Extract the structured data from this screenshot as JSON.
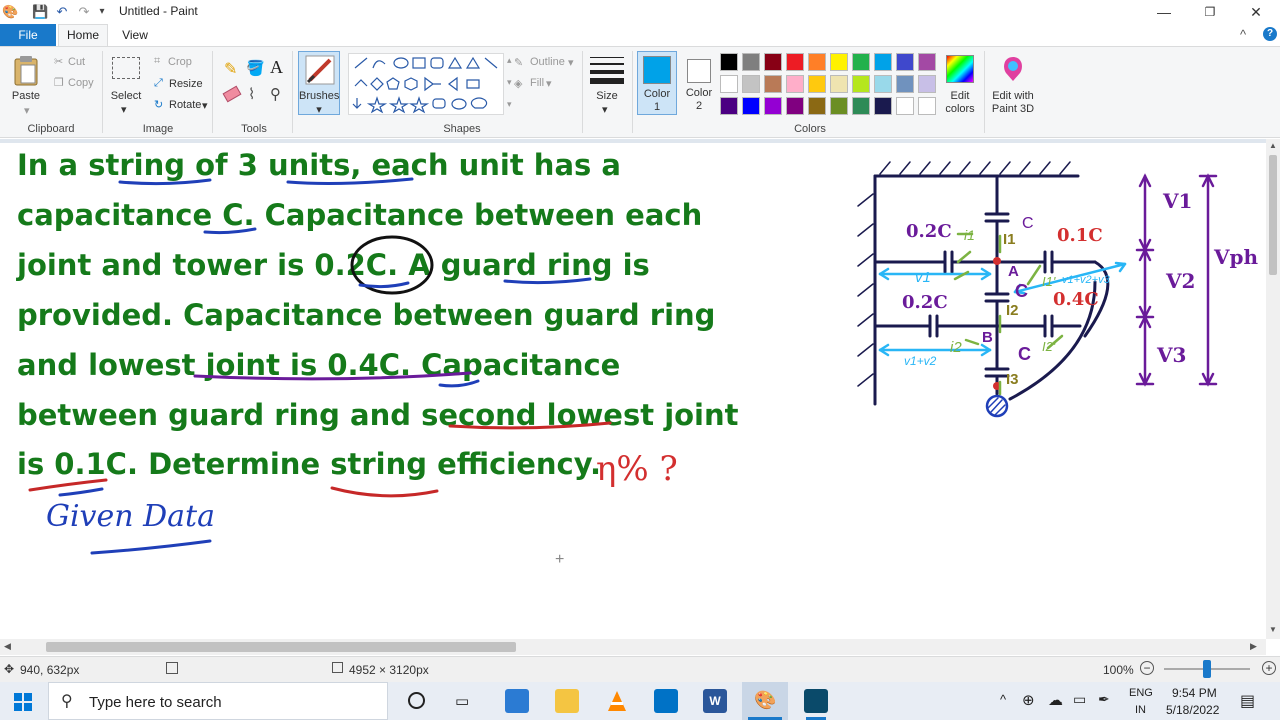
{
  "window": {
    "title": "Untitled - Paint",
    "controls": {
      "minimize": "—",
      "maximize": "❐",
      "close": "✕"
    }
  },
  "quick_access": {
    "save": "💾",
    "undo": "↶",
    "redo": "↷",
    "customize": "▾"
  },
  "tabs": [
    {
      "label": "File"
    },
    {
      "label": "Home"
    },
    {
      "label": "View"
    }
  ],
  "help": {
    "collapse": "^",
    "help": "?"
  },
  "ribbon": {
    "clipboard": {
      "group": "Clipboard",
      "paste": "Paste",
      "cut": "Cut",
      "copy": "Copy"
    },
    "image": {
      "group": "Image",
      "select": "Select",
      "crop": "Crop",
      "resize": "Resize",
      "rotate": "Rotate"
    },
    "tools": {
      "group": "Tools"
    },
    "brushes": {
      "label": "Brushes"
    },
    "shapes": {
      "group": "Shapes",
      "outline": "Outline",
      "fill": "Fill"
    },
    "size": {
      "label": "Size"
    },
    "color1": {
      "label": "Color",
      "num": "1"
    },
    "color2": {
      "label": "Color",
      "num": "2"
    },
    "colors": {
      "group": "Colors",
      "edit": "Edit colors",
      "edit_l1": "Edit",
      "edit_l2": "colors"
    },
    "paint3d": {
      "l1": "Edit with",
      "l2": "Paint 3D"
    },
    "palette_row1": [
      "#000000",
      "#7f7f7f",
      "#880015",
      "#ed1c24",
      "#ff7f27",
      "#fff200",
      "#22b14c",
      "#00a2e8",
      "#3f48cc",
      "#a349a4"
    ],
    "palette_row2": [
      "#ffffff",
      "#c3c3c3",
      "#b97a57",
      "#ffaec9",
      "#ffc90e",
      "#efe4b0",
      "#b5e61d",
      "#99d9ea",
      "#7092be",
      "#c8bfe7"
    ],
    "palette_row3": [
      "#4b0082",
      "#0000ff",
      "#9400d3",
      "#800080",
      "#8b6914",
      "#6b8e23",
      "#2e8b57",
      "#1a1a4e",
      "#ffffff",
      "#ffffff"
    ],
    "color1_value": "#00a2e8"
  },
  "canvas": {
    "lines": [
      "In a string of 3 units, each unit has a",
      "capacitance C. Capacitance between each",
      "joint and tower is 0.2C. A guard ring is",
      "provided. Capacitance between guard ring",
      "and lowest joint is 0.4C. Capacitance",
      "between guard ring and second lowest joint",
      "is 0.1C. Determine string efficiency."
    ],
    "eta_note": "η% ?",
    "given": "Given Data",
    "diagram": {
      "c02_top": "0.2C",
      "c02_mid": "0.2C",
      "c01": "0.1C",
      "c04": "0.4C",
      "c_top": "C",
      "c_mid": "C",
      "c_bot": "C",
      "i1_green": "i1",
      "I1": "I1",
      "I2": "I2",
      "I3": "I3",
      "i2_green": "i2",
      "I1p": "I1'",
      "I2p": "I2'",
      "node_a": "A",
      "node_b": "B",
      "v1_arrow": "v1",
      "v2_arrow": "v2",
      "v3_arrow": "v1+v2",
      "v1v2v3": "v1+v2+v3",
      "V1": "V1",
      "V2": "V2",
      "V3": "V3",
      "Vph": "Vph"
    }
  },
  "status": {
    "cursor_pos": "940, 632px",
    "image_size": "4952 × 3120px",
    "zoom": "100%"
  },
  "taskbar": {
    "search_placeholder": "Type here to search",
    "lang_top": "ENG",
    "lang_bottom": "IN",
    "time": "9:54 PM",
    "date": "5/18/2022"
  }
}
